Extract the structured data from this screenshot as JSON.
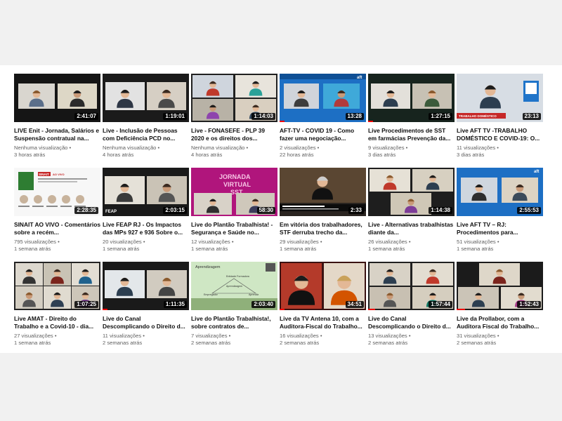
{
  "videos": [
    {
      "title": "LIVE Enit - Jornada, Salários e Suspensão contratual na...",
      "views": "Nenhuma visualização",
      "age": "3 horas atrás",
      "duration": "2:41:07",
      "progress": 0
    },
    {
      "title": "Live - Inclusão de Pessoas com Deficiência PCD no...",
      "views": "Nenhuma visualização",
      "age": "4 horas atrás",
      "duration": "1:19:01",
      "progress": 0
    },
    {
      "title": "Live - FONASEFE - PLP 39 2020 e os direitos dos...",
      "views": "Nenhuma visualização",
      "age": "4 horas atrás",
      "duration": "1:14:03",
      "progress": 0
    },
    {
      "title": "AFT-TV - COVID 19 - Como fazer uma negociação...",
      "views": "2 visualizações",
      "age": "22 horas atrás",
      "duration": "13:28",
      "progress": 0.06
    },
    {
      "title": "Live Procedimentos de SST em farmácias Prevenção da...",
      "views": "9 visualizações",
      "age": "3 dias atrás",
      "duration": "1:27:15",
      "progress": 0.06
    },
    {
      "title": "Live AFT TV -TRABALHO DOMÉSTICO E COVID-19: O...",
      "views": "11 visualizações",
      "age": "3 dias atrás",
      "duration": "23:13",
      "progress": 0
    },
    {
      "title": "SINAIT AO VIVO - Comentários sobre a recém...",
      "views": "795 visualizações",
      "age": "1 semana atrás",
      "duration": "2:28:35",
      "progress": 0
    },
    {
      "title": "Live FEAP RJ - Os Impactos das MPs 927 e 936 Sobre o...",
      "views": "20 visualizações",
      "age": "1 semana atrás",
      "duration": "2:03:15",
      "progress": 0
    },
    {
      "title": "Live do Plantão Trabalhista! - Segurança e Saúde no...",
      "views": "12 visualizações",
      "age": "1 semana atrás",
      "duration": "58:30",
      "progress": 0
    },
    {
      "title": "Em vitória dos trabalhadores, STF derruba trecho da...",
      "views": "29 visualizações",
      "age": "1 semana atrás",
      "duration": "2:33",
      "progress": 0
    },
    {
      "title": "Live - Alternativas trabalhistas diante da...",
      "views": "26 visualizações",
      "age": "1 semana atrás",
      "duration": "1:14:38",
      "progress": 0
    },
    {
      "title": "Live AFT TV – RJ: Procedimentos para...",
      "views": "51 visualizações",
      "age": "1 semana atrás",
      "duration": "2:55:53",
      "progress": 0
    },
    {
      "title": "Live AMAT - Direito do Trabalho e a Covid-10 - dia...",
      "views": "27 visualizações",
      "age": "1 semana atrás",
      "duration": "1:07:25",
      "progress": 0
    },
    {
      "title": "Live do Canal Descomplicando o Direito d...",
      "views": "11 visualizações",
      "age": "2 semanas atrás",
      "duration": "1:11:35",
      "progress": 0.06
    },
    {
      "title": "Live do Plantão Trabalhista!, sobre contratos de...",
      "views": "7 visualizações",
      "age": "2 semanas atrás",
      "duration": "2:03:40",
      "progress": 0
    },
    {
      "title": "Live da TV Antena 10, com a Auditora-Fiscal do Trabalho...",
      "views": "16 visualizações",
      "age": "2 semanas atrás",
      "duration": "34:51",
      "progress": 0.06
    },
    {
      "title": "Live do Canal Descomplicando o Direito d...",
      "views": "13 visualizações",
      "age": "2 semanas atrás",
      "duration": "1:57:44",
      "progress": 0.08
    },
    {
      "title": "Live da Prollabor, com a Auditora Fiscal do Trabalho...",
      "views": "31 visualizações",
      "age": "2 semanas atrás",
      "duration": "1:52:43",
      "progress": 0.1
    }
  ],
  "thumbnail_labels": {
    "flyer_badge": "SINAIT",
    "flyer_live_tag": "AO VIVO",
    "chart_heading": "Aprendizagem",
    "chart_node_top": "Entidade Formadora",
    "chart_node_center": "Aprendizagem",
    "chart_node_left": "Empregador",
    "chart_node_right": "Aprendiz",
    "poster_word_1": "JORNADA",
    "poster_word_2": "VIRTUAL",
    "poster_word_3": "SST",
    "brand_tag": "aft",
    "feap_logo": "FEAP",
    "tv_banner": "TRABALHO DOMÉSTICO"
  },
  "colors": {
    "progress": "#ee0000",
    "title_text": "#0f0f0f",
    "meta_text": "#606060",
    "page_bg": "#f1f1f1"
  }
}
